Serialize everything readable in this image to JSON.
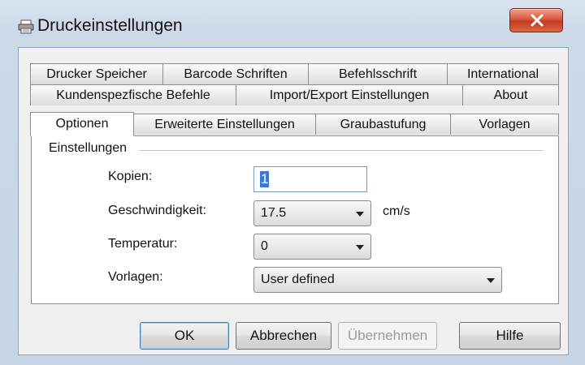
{
  "window": {
    "title": "Druckeinstellungen",
    "icon": "printer-icon"
  },
  "tabs": {
    "row1": [
      "Drucker Speicher",
      "Barcode Schriften",
      "Befehlsschrift",
      "International"
    ],
    "row2": [
      "Kundenspezfische Befehle",
      "Import/Export Einstellungen",
      "About"
    ],
    "row3": [
      "Optionen",
      "Erweiterte Einstellungen",
      "Graubastufung",
      "Vorlagen"
    ],
    "active": "Optionen"
  },
  "group": {
    "label": "Einstellungen"
  },
  "fields": {
    "copies": {
      "label": "Kopien:",
      "value": "1"
    },
    "speed": {
      "label": "Geschwindigkeit:",
      "value": "17.5",
      "unit": "cm/s"
    },
    "temperature": {
      "label": "Temperatur:",
      "value": "0"
    },
    "templates": {
      "label": "Vorlagen:",
      "value": "User defined"
    }
  },
  "buttons": {
    "ok": "OK",
    "cancel": "Abbrechen",
    "apply": "Übernehmen",
    "help": "Hilfe"
  },
  "colors": {
    "close_button": "#d9593f",
    "selection": "#3a79d6"
  }
}
